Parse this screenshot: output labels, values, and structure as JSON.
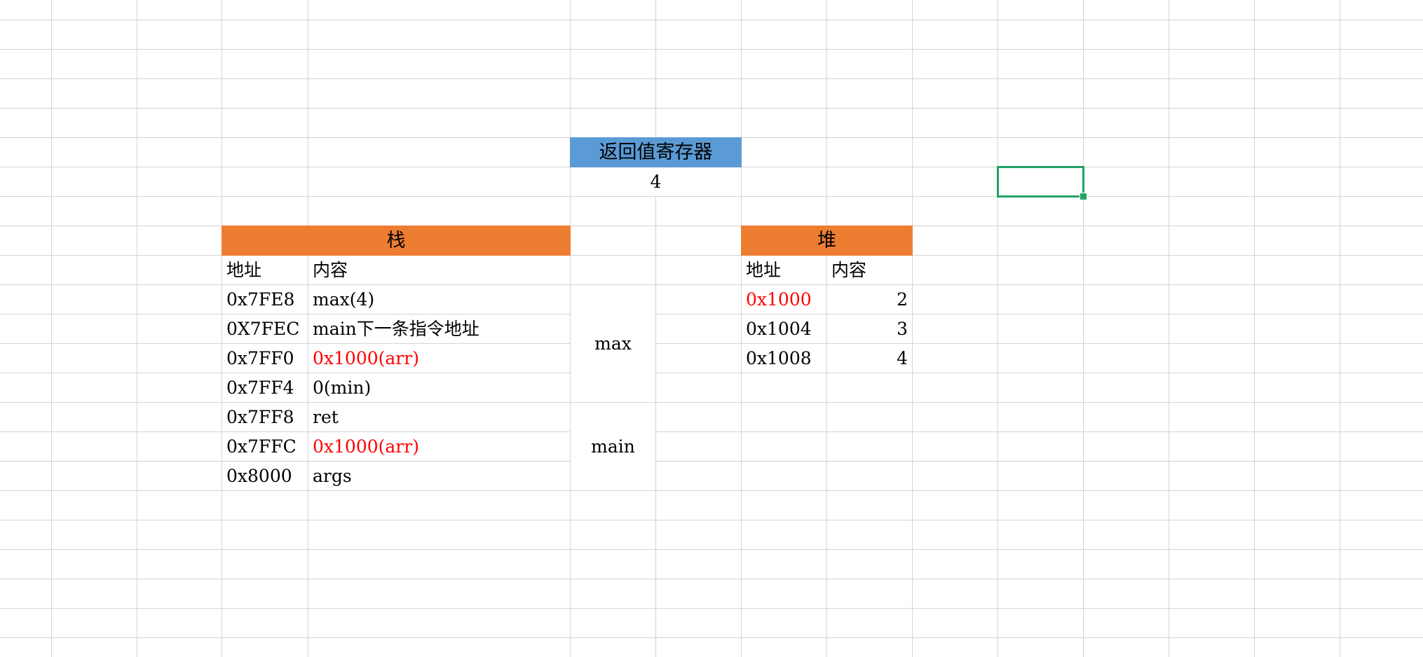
{
  "return_register": {
    "header": "返回值寄存器",
    "value": "4"
  },
  "stack": {
    "header": "栈",
    "col_address": "地址",
    "col_content": "内容",
    "rows": [
      {
        "address": "0x7FE8",
        "content": "max(4)"
      },
      {
        "address": "0X7FEC",
        "content": "main下一条指令地址"
      },
      {
        "address": "0x7FF0",
        "content": "0x1000(arr)",
        "highlight": "#ff0000"
      },
      {
        "address": "0x7FF4",
        "content": "0(min)"
      },
      {
        "address": "0x7FF8",
        "content": "ret"
      },
      {
        "address": "0x7FFC",
        "content": "0x1000(arr)",
        "highlight": "#ff0000"
      },
      {
        "address": "0x8000",
        "content": "args"
      }
    ],
    "frames": [
      "max",
      "main"
    ]
  },
  "heap": {
    "header": "堆",
    "col_address": "地址",
    "col_content": "内容",
    "rows": [
      {
        "address": "0x1000",
        "content": "2",
        "highlight": "#ff0000"
      },
      {
        "address": "0x1004",
        "content": "3"
      },
      {
        "address": "0x1008",
        "content": "4"
      }
    ]
  },
  "colors": {
    "header_orange": "#ed7d31",
    "header_blue": "#5b9bd5",
    "highlight_red": "#ff0000",
    "selection_green": "#21a366",
    "gridline": "#d4d4d4"
  }
}
